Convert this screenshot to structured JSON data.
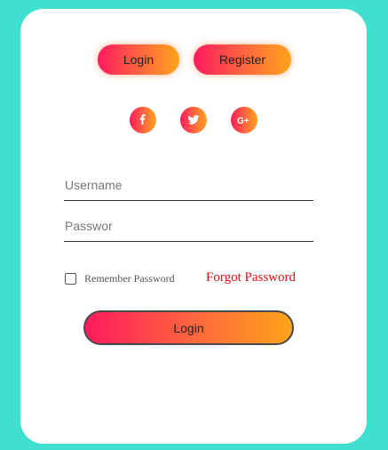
{
  "tabs": {
    "login_label": "Login",
    "register_label": "Register"
  },
  "social": [
    {
      "icon": "facebook-icon",
      "glyph": "f"
    },
    {
      "icon": "twitter-icon",
      "glyph": "bird"
    },
    {
      "icon": "google-plus-icon",
      "glyph": "G+"
    }
  ],
  "form": {
    "username_placeholder": "Username",
    "password_placeholder": "Passwor",
    "remember_label": "Remember Password",
    "forgot_label": "Forgot Password",
    "submit_label": "Login"
  },
  "colors": {
    "background": "#40e0d0",
    "gradient_start": "#ff1a5e",
    "gradient_end": "#ffa41b",
    "forgot_link": "#e01010"
  }
}
